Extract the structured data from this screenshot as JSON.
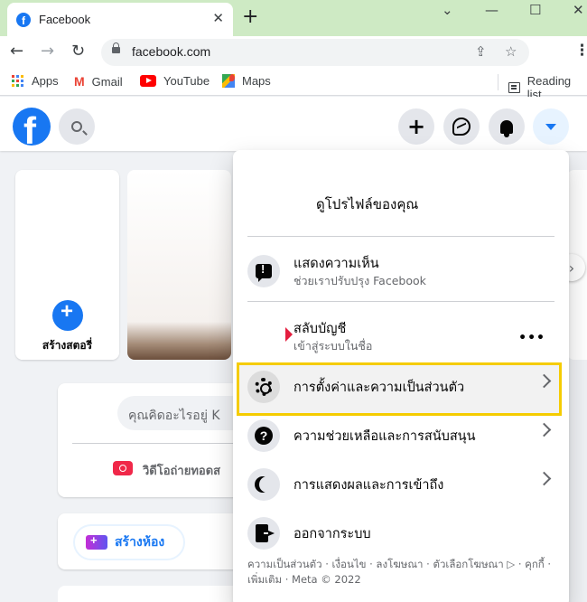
{
  "browser": {
    "tab_title": "Facebook",
    "tab_close": "✕",
    "new_tab": "+",
    "window_controls": [
      "⌄",
      "—",
      "☐",
      "✕"
    ],
    "url": "facebook.com",
    "bookmarks": [
      {
        "label": "Apps",
        "icon": "apps-grid-icon"
      },
      {
        "label": "Gmail",
        "icon": "gmail-icon"
      },
      {
        "label": "YouTube",
        "icon": "youtube-icon"
      },
      {
        "label": "Maps",
        "icon": "maps-icon"
      }
    ],
    "reading_list": "Reading list"
  },
  "feed": {
    "create_story": "สร้างสตอรี่",
    "composer_placeholder": "คุณคิดอะไรอยู่ K",
    "live_video": "วิดีโอถ่ายทอดส",
    "create_room": "สร้างห้อง"
  },
  "menu": {
    "profile": "ดูโปรไฟล์ของคุณ",
    "feedback": {
      "title": "แสดงความเห็น",
      "subtitle": "ช่วยเราปรับปรุง Facebook"
    },
    "switch_account": {
      "title": "สลับบัญชี",
      "subtitle": "เข้าสู่ระบบในชื่อ",
      "more": "•••"
    },
    "settings": "การตั้งค่าและความเป็นส่วนตัว",
    "help": "ความช่วยเหลือและการสนับสนุน",
    "display": "การแสดงผลและการเข้าถึง",
    "logout": "ออกจากระบบ",
    "footer": "ความเป็นส่วนตัว · เงื่อนไข · ลงโฆษณา · ตัวเลือกโฆษณา ▷ · คุกกี้ · เพิ่มเติม · Meta © 2022"
  },
  "colors": {
    "brand": "#1877f2",
    "highlight": "#f5cc00",
    "tab_strip": "#ceeac4"
  }
}
